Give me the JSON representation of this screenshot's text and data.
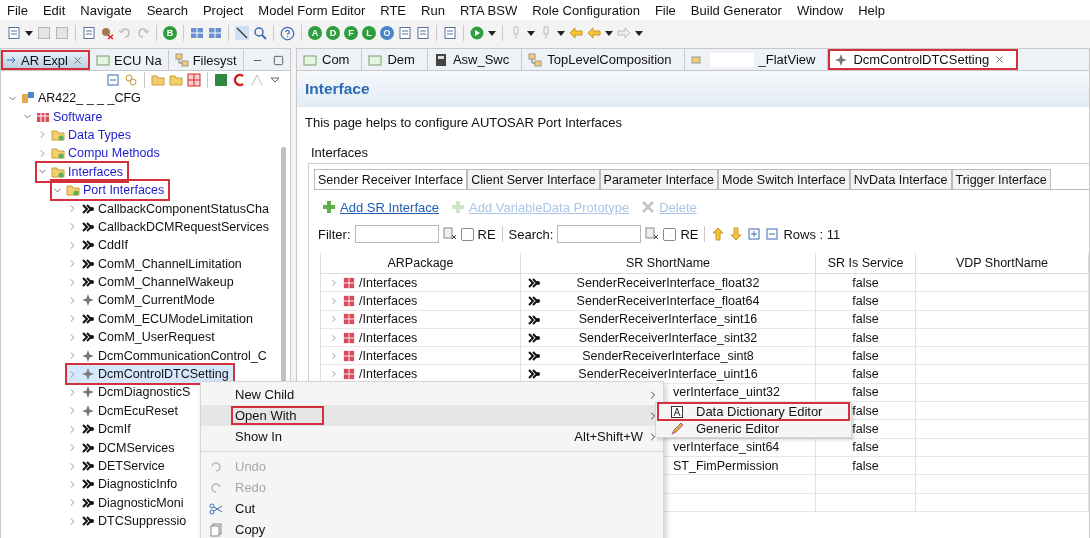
{
  "menu_bar": [
    "File",
    "Edit",
    "Navigate",
    "Search",
    "Project",
    "Model Form Editor",
    "RTE",
    "Run",
    "RTA BSW",
    "Role Configuration",
    "File",
    "Build Generator",
    "Window",
    "Help"
  ],
  "toolbar": [
    {
      "kind": "doc"
    },
    {
      "kind": "caret"
    },
    {
      "kind": "save"
    },
    {
      "kind": "save"
    },
    {
      "kind": "sep"
    },
    {
      "kind": "doc"
    },
    {
      "kind": "bug"
    },
    {
      "kind": "undo"
    },
    {
      "kind": "redo"
    },
    {
      "kind": "sep"
    },
    {
      "kind": "badge",
      "label": "B",
      "color": "#2e9e3e"
    },
    {
      "kind": "sep"
    },
    {
      "kind": "grid"
    },
    {
      "kind": "grid"
    },
    {
      "kind": "sep"
    },
    {
      "kind": "wand"
    },
    {
      "kind": "zoom"
    },
    {
      "kind": "sep"
    },
    {
      "kind": "help"
    },
    {
      "kind": "sep"
    },
    {
      "kind": "badge",
      "label": "A",
      "color": "#2e9e3e"
    },
    {
      "kind": "badge",
      "label": "D",
      "color": "#2e9e3e"
    },
    {
      "kind": "badge",
      "label": "F",
      "color": "#2e9e3e"
    },
    {
      "kind": "badge",
      "label": "L",
      "color": "#2e9e3e"
    },
    {
      "kind": "badge",
      "label": "O",
      "color": "#4a86c8"
    },
    {
      "kind": "doc"
    },
    {
      "kind": "doc"
    },
    {
      "kind": "sep"
    },
    {
      "kind": "doc"
    },
    {
      "kind": "sep"
    },
    {
      "kind": "play"
    },
    {
      "kind": "caret"
    },
    {
      "kind": "sep"
    },
    {
      "kind": "pin"
    },
    {
      "kind": "caret"
    },
    {
      "kind": "pin"
    },
    {
      "kind": "caret"
    },
    {
      "kind": "back"
    },
    {
      "kind": "back"
    },
    {
      "kind": "caret"
    },
    {
      "kind": "forward"
    },
    {
      "kind": "caret"
    }
  ],
  "explorer": {
    "tabs": [
      {
        "label": "AR Expl",
        "selected": true,
        "annotated": true
      },
      {
        "label": "ECU Na",
        "selected": false,
        "annotated": false
      },
      {
        "label": "Filesyst",
        "selected": false,
        "annotated": false
      }
    ],
    "tree": [
      {
        "label": "AR422_ _ _ _CFG",
        "kind": "project",
        "expanded": true,
        "selected": false,
        "annotated": false,
        "children": [
          {
            "label": "Software",
            "kind": "package",
            "expanded": true,
            "selected": false,
            "annotated": false,
            "children": [
              {
                "label": "Data Types",
                "kind": "folder",
                "expanded": false,
                "selected": false,
                "annotated": false
              },
              {
                "label": "Compu Methods",
                "kind": "folder",
                "expanded": false,
                "selected": false,
                "annotated": false
              },
              {
                "label": "Interfaces",
                "kind": "folder",
                "expanded": true,
                "selected": false,
                "annotated": true,
                "children": [
                  {
                    "label": "Port Interfaces",
                    "kind": "folder",
                    "expanded": true,
                    "selected": false,
                    "annotated": true,
                    "children": [
                      {
                        "label": "CallbackComponentStatusCha",
                        "kind": "sr",
                        "expanded": false,
                        "selected": false,
                        "annotated": false
                      },
                      {
                        "label": "CallbackDCMRequestServices",
                        "kind": "sr",
                        "expanded": false,
                        "selected": false,
                        "annotated": false
                      },
                      {
                        "label": "CddIf",
                        "kind": "sr",
                        "expanded": false,
                        "selected": false,
                        "annotated": false
                      },
                      {
                        "label": "ComM_ChannelLimitation",
                        "kind": "sr",
                        "expanded": false,
                        "selected": false,
                        "annotated": false
                      },
                      {
                        "label": "ComM_ChannelWakeup",
                        "kind": "sr",
                        "expanded": false,
                        "selected": false,
                        "annotated": false
                      },
                      {
                        "label": "ComM_CurrentMode",
                        "kind": "mode",
                        "expanded": false,
                        "selected": false,
                        "annotated": false
                      },
                      {
                        "label": "ComM_ECUModeLimitation",
                        "kind": "sr",
                        "expanded": false,
                        "selected": false,
                        "annotated": false
                      },
                      {
                        "label": "ComM_UserRequest",
                        "kind": "sr",
                        "expanded": false,
                        "selected": false,
                        "annotated": false
                      },
                      {
                        "label": "DcmCommunicationControl_C",
                        "kind": "mode",
                        "expanded": false,
                        "selected": false,
                        "annotated": false
                      },
                      {
                        "label": "DcmControlDTCSetting",
                        "kind": "mode",
                        "expanded": false,
                        "selected": true,
                        "annotated": true
                      },
                      {
                        "label": "DcmDiagnosticS",
                        "kind": "mode",
                        "expanded": false,
                        "selected": false,
                        "annotated": false
                      },
                      {
                        "label": "DcmEcuReset",
                        "kind": "mode",
                        "expanded": false,
                        "selected": false,
                        "annotated": false
                      },
                      {
                        "label": "DcmIf",
                        "kind": "sr",
                        "expanded": false,
                        "selected": false,
                        "annotated": false
                      },
                      {
                        "label": "DCMServices",
                        "kind": "sr",
                        "expanded": false,
                        "selected": false,
                        "annotated": false
                      },
                      {
                        "label": "DETService",
                        "kind": "sr",
                        "expanded": false,
                        "selected": false,
                        "annotated": false
                      },
                      {
                        "label": "DiagnosticInfo",
                        "kind": "sr",
                        "expanded": false,
                        "selected": false,
                        "annotated": false
                      },
                      {
                        "label": "DiagnosticMoni",
                        "kind": "sr",
                        "expanded": false,
                        "selected": false,
                        "annotated": false
                      },
                      {
                        "label": "DTCSuppressio",
                        "kind": "sr",
                        "expanded": false,
                        "selected": false,
                        "annotated": false
                      }
                    ]
                  }
                ]
              }
            ]
          }
        ]
      }
    ]
  },
  "editor": {
    "tabs": [
      {
        "label": "Com",
        "kind": "module",
        "selected": false,
        "annotated": false
      },
      {
        "label": "Dem",
        "kind": "module",
        "selected": false,
        "annotated": false
      },
      {
        "label": "Asw_Swc",
        "kind": "book",
        "selected": false,
        "annotated": false
      },
      {
        "label": "TopLevelComposition",
        "kind": "composition",
        "selected": false,
        "annotated": false
      },
      {
        "label": "_FlatView",
        "kind": "redacted",
        "selected": false,
        "annotated": false
      },
      {
        "label": "DcmControlDTCSetting",
        "kind": "mode",
        "selected": true,
        "annotated": true
      }
    ],
    "title": "Interface",
    "description": "This page helps to configure AUTOSAR Port Interfaces",
    "group": {
      "label": "Interfaces",
      "tabs": [
        {
          "label": "Sender Receiver Interface",
          "selected": true
        },
        {
          "label": "Client Server Interface",
          "selected": false
        },
        {
          "label": "Parameter Interface",
          "selected": false
        },
        {
          "label": "Mode Switch Interface",
          "selected": false
        },
        {
          "label": "NvData Interface",
          "selected": false
        },
        {
          "label": "Trigger Interface",
          "selected": false
        }
      ],
      "actions": [
        {
          "kind": "add",
          "label": "Add SR Interface",
          "disabled": false
        },
        {
          "kind": "add",
          "label": "Add VariableData Prototype",
          "disabled": true
        },
        {
          "kind": "delete",
          "label": "Delete",
          "disabled": true
        }
      ],
      "filter": {
        "label": "Filter:",
        "re_label": "RE",
        "re_checked": false
      },
      "search": {
        "label": "Search:",
        "re_label": "RE",
        "re_checked": false
      },
      "rows_count": "Rows : 11",
      "table": {
        "columns": [
          "ARPackage",
          "SR ShortName",
          "SR Is Service",
          "VDP ShortName"
        ],
        "rows": [
          {
            "kind": "full",
            "package": "/Interfaces",
            "name": "SenderReceiverInterface_float32",
            "is_service": "false"
          },
          {
            "kind": "full",
            "package": "/Interfaces",
            "name": "SenderReceiverInterface_float64",
            "is_service": "false"
          },
          {
            "kind": "full",
            "package": "/Interfaces",
            "name": "SenderReceiverInterface_sint16",
            "is_service": "false"
          },
          {
            "kind": "full",
            "package": "/Interfaces",
            "name": "SenderReceiverInterface_sint32",
            "is_service": "false"
          },
          {
            "kind": "full",
            "package": "/Interfaces",
            "name": "SenderReceiverInterface_sint8",
            "is_service": "false"
          },
          {
            "kind": "full",
            "package": "/Interfaces",
            "name": "SenderReceiverInterface_uint16",
            "is_service": "false"
          },
          {
            "kind": "covered",
            "name": "verInterface_uint32",
            "is_service": "false"
          },
          {
            "kind": "covered",
            "is_service": "false"
          },
          {
            "kind": "covered",
            "is_service": "false"
          },
          {
            "kind": "covered",
            "name": "verInterface_sint64",
            "is_service": "false"
          },
          {
            "kind": "covered",
            "name": "ST_FimPermission",
            "is_service": "false"
          }
        ]
      }
    }
  },
  "context_menu": {
    "items": [
      {
        "kind": "plain",
        "label": "New Child",
        "submenu": true,
        "selected": false,
        "annotated": false,
        "disabled": false
      },
      {
        "kind": "plain",
        "label": "Open With",
        "submenu": true,
        "selected": true,
        "annotated": true,
        "disabled": false
      },
      {
        "kind": "plain",
        "label": "Show In",
        "shortcut": "Alt+Shift+W",
        "submenu": true,
        "selected": false,
        "annotated": false,
        "disabled": false
      },
      {
        "kind": "separator"
      },
      {
        "kind": "undo",
        "label": "Undo",
        "submenu": false,
        "selected": false,
        "annotated": false,
        "disabled": true
      },
      {
        "kind": "redo",
        "label": "Redo",
        "submenu": false,
        "selected": false,
        "annotated": false,
        "disabled": true
      },
      {
        "kind": "cut",
        "label": "Cut",
        "submenu": false,
        "selected": false,
        "annotated": false,
        "disabled": false
      },
      {
        "kind": "copy",
        "label": "Copy",
        "submenu": false,
        "selected": false,
        "annotated": false,
        "disabled": false
      }
    ],
    "submenu": [
      {
        "kind": "dictionary",
        "label": "Data Dictionary Editor",
        "annotated": true
      },
      {
        "kind": "pencil",
        "label": "Generic Editor",
        "annotated": false
      }
    ]
  }
}
